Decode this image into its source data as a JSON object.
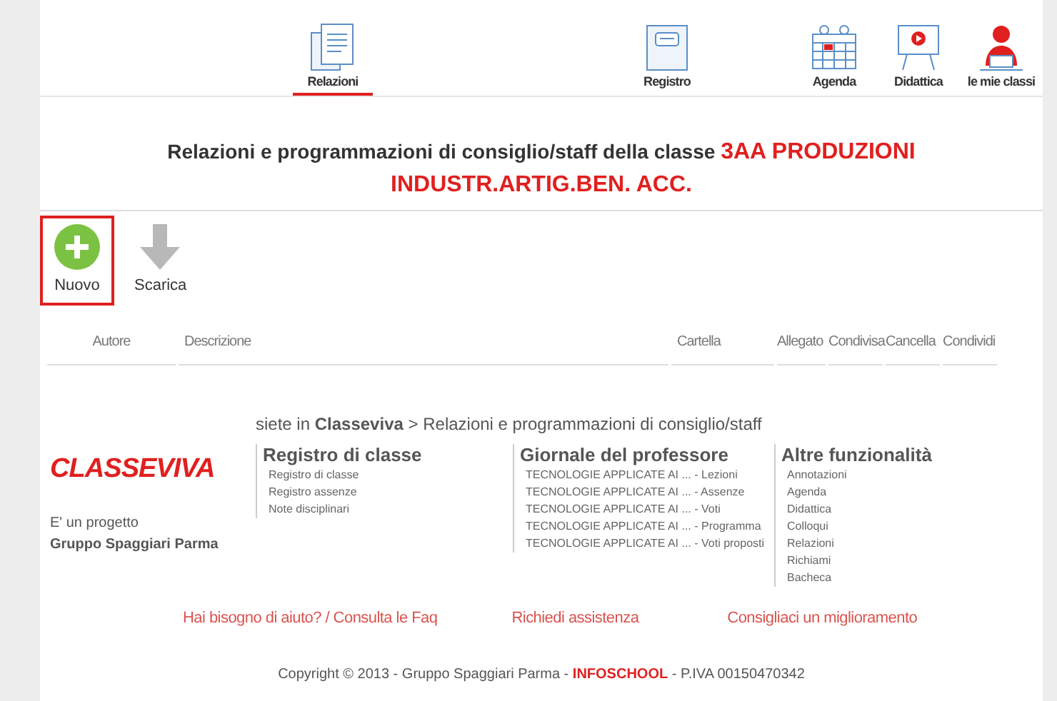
{
  "nav": [
    {
      "label": "Relazioni",
      "selected": true
    },
    {
      "label": "Registro",
      "selected": false
    },
    {
      "label": "Agenda",
      "selected": false
    },
    {
      "label": "Didattica",
      "selected": false
    },
    {
      "label": "le mie classi",
      "selected": false
    }
  ],
  "heading": "Relazioni e programmazioni di consiglio/staff della classe **3AA PRODUZIONI INDUSTR.ARTIG.BEN. ACC.**",
  "toolbar": [
    {
      "label": "Nuovo",
      "kind": "add",
      "highlighted": true
    },
    {
      "label": "Scarica",
      "kind": "download",
      "highlighted": false
    }
  ],
  "table": {
    "columns": [
      "Autore",
      "Descrizione",
      "Cartella",
      "Allegato",
      "Condivisa",
      "Cancella",
      "Condividi"
    ]
  },
  "breadcrumb": "siete in **Classeviva** > Relazioni e programmazioni di consiglio/staff",
  "footer": {
    "logo": "CLASSEVIVA",
    "project_line": "E' un progetto",
    "company": "Gruppo Spaggiari Parma",
    "sections": [
      {
        "title": "Registro di classe",
        "links": [
          "Registro di classe",
          "Registro assenze",
          "Note disciplinari"
        ]
      },
      {
        "title": "Giornale del professore",
        "links": [
          "TECNOLOGIE APPLICATE AI ... - Lezioni",
          "TECNOLOGIE APPLICATE AI ... - Assenze",
          "TECNOLOGIE APPLICATE AI ... - Voti",
          "TECNOLOGIE APPLICATE AI ... - Programma",
          "TECNOLOGIE APPLICATE AI ... - Voti proposti"
        ]
      },
      {
        "title": "Altre funzionalità",
        "links": [
          "Annotazioni",
          "Agenda",
          "Didattica",
          "Colloqui",
          "Relazioni",
          "Richiami",
          "Bacheca"
        ]
      }
    ],
    "help_links": [
      "Hai bisogno di aiuto? / Consulta le Faq",
      "Richiedi assistenza",
      "Consigliaci un miglioramento"
    ],
    "copyright": "Copyright © 2013 - Gruppo Spaggiari Parma - **INFOSCHOOL** - P.IVA 00150470342"
  }
}
